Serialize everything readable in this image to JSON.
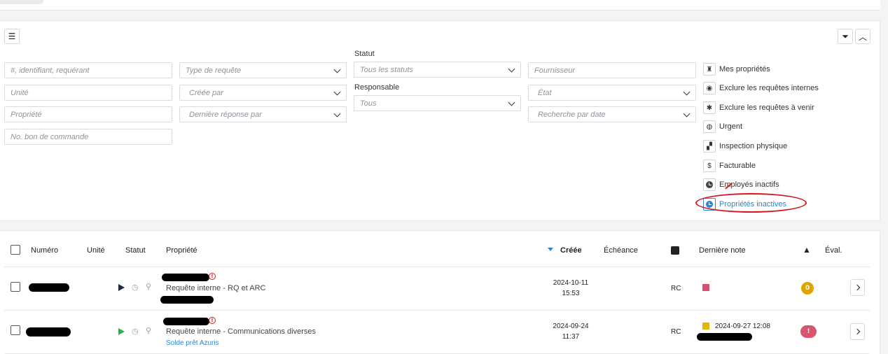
{
  "filters": {
    "search_placeholder": "#, identifiant, requérant",
    "unit_placeholder": "Unité",
    "property_placeholder": "Propriété",
    "po_placeholder": "No. bon de commande",
    "request_type_placeholder": "Type de requête",
    "created_by_placeholder": "Créée par",
    "last_reply_placeholder": "Dernière réponse par",
    "status_label": "Statut",
    "status_value": "Tous les statuts",
    "responsible_label": "Responsable",
    "responsible_value": "Tous",
    "supplier_placeholder": "Fournisseur",
    "state_placeholder": "État",
    "date_search_placeholder": "Recherche par date",
    "filter_clear_icon": "filter-clear-icon",
    "collapse_icon": "chevron-up-icon",
    "settings_icon": "sliders-icon"
  },
  "quick_filters": [
    {
      "label": "Mes propriétés",
      "icon": "person-icon",
      "glyph": "♜"
    },
    {
      "label": "Exclure les requêtes internes",
      "icon": "eye-icon",
      "glyph": "◉"
    },
    {
      "label": "Exclure les requêtes à venir",
      "icon": "asterisk-icon",
      "glyph": "✱"
    },
    {
      "label": "Urgent",
      "icon": "fire-icon",
      "glyph": "◍"
    },
    {
      "label": "Inspection physique",
      "icon": "binoculars-icon",
      "glyph": "▞"
    },
    {
      "label": "Facturable",
      "icon": "dollar-icon",
      "glyph": "$"
    },
    {
      "label": "Employés inactifs",
      "icon": "clock-icon",
      "glyph": ""
    },
    {
      "label": "Propriétés inactives",
      "icon": "clock-icon",
      "glyph": "",
      "active": true
    }
  ],
  "table": {
    "headers": {
      "number": "Numéro",
      "unit": "Unité",
      "status": "Statut",
      "property": "Propriété",
      "created": "Créée",
      "due": "Échéance",
      "last_note": "Dernière note",
      "eval": "Éval."
    },
    "rows": [
      {
        "request_line": "Requête interne - RQ et ARC",
        "created_date": "2024-10-11",
        "created_time": "15:53",
        "initials": "RC",
        "note_color": "#d94f6f",
        "note_date": "",
        "eval_badge": "0",
        "eval_color": "#e0a400",
        "sub_link": ""
      },
      {
        "request_line": "Requête interne - Communications diverses",
        "created_date": "2024-09-24",
        "created_time": "11:37",
        "initials": "RC",
        "note_color": "#e0b400",
        "note_date": "2024-09-27 12:08",
        "eval_badge": "!",
        "eval_color": "#d9546f",
        "sub_link": "Solde prêt Azuris"
      }
    ]
  },
  "colors": {
    "accent": "#2c86d1",
    "annotation": "#d3161f"
  }
}
